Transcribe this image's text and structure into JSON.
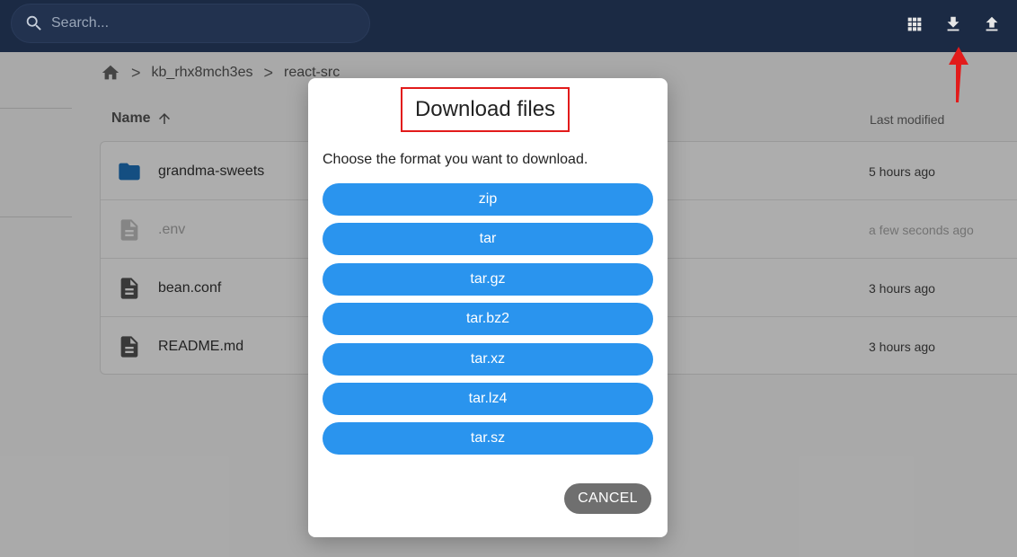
{
  "topbar": {
    "search_placeholder": "Search...",
    "icons": [
      "grid-view-icon",
      "download-icon",
      "upload-icon"
    ]
  },
  "breadcrumb": {
    "home_icon": "home-icon",
    "items": [
      "kb_rhx8mch3es",
      "react-src"
    ],
    "separator": ">"
  },
  "list": {
    "header_name": "Name",
    "header_modified": "Last modified",
    "sort_icon": "arrow-up-icon",
    "rows": [
      {
        "name": "grandma-sweets",
        "modified": "5 hours ago",
        "icon": "folder-icon"
      },
      {
        "name": ".env",
        "modified": "a few seconds ago",
        "icon": "file-icon"
      },
      {
        "name": "bean.conf",
        "modified": "3 hours ago",
        "icon": "file-icon"
      },
      {
        "name": "README.md",
        "modified": "3 hours ago",
        "icon": "file-icon"
      }
    ]
  },
  "dialog": {
    "title": "Download files",
    "description": "Choose the format you want to download.",
    "formats": [
      "zip",
      "tar",
      "tar.gz",
      "tar.bz2",
      "tar.xz",
      "tar.lz4",
      "tar.sz"
    ],
    "cancel_label": "CANCEL"
  },
  "colors": {
    "topbar": "#1b2a44",
    "format_button": "#2a94ee",
    "cancel_button": "#6f6f6f",
    "annotation": "#e21b1b",
    "folder": "#1e73be"
  }
}
